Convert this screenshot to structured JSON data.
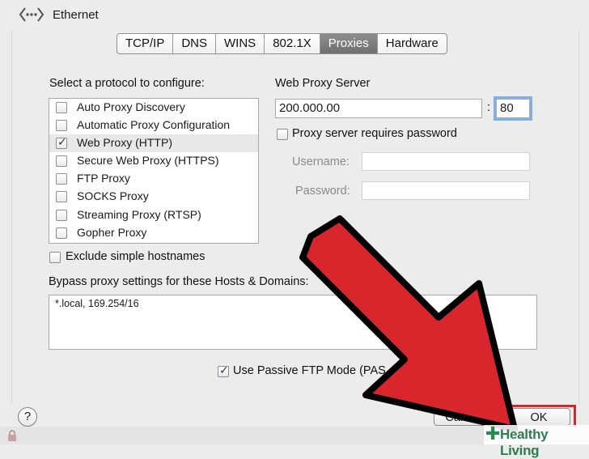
{
  "window": {
    "title": "Ethernet"
  },
  "tabs": [
    {
      "label": "TCP/IP",
      "active": false
    },
    {
      "label": "DNS",
      "active": false
    },
    {
      "label": "WINS",
      "active": false
    },
    {
      "label": "802.1X",
      "active": false
    },
    {
      "label": "Proxies",
      "active": true
    },
    {
      "label": "Hardware",
      "active": false
    }
  ],
  "protocols": {
    "heading": "Select a protocol to configure:",
    "items": [
      {
        "label": "Auto Proxy Discovery",
        "checked": false,
        "selected": false
      },
      {
        "label": "Automatic Proxy Configuration",
        "checked": false,
        "selected": false
      },
      {
        "label": "Web Proxy (HTTP)",
        "checked": true,
        "selected": true
      },
      {
        "label": "Secure Web Proxy (HTTPS)",
        "checked": false,
        "selected": false
      },
      {
        "label": "FTP Proxy",
        "checked": false,
        "selected": false
      },
      {
        "label": "SOCKS Proxy",
        "checked": false,
        "selected": false
      },
      {
        "label": "Streaming Proxy (RTSP)",
        "checked": false,
        "selected": false
      },
      {
        "label": "Gopher Proxy",
        "checked": false,
        "selected": false
      }
    ]
  },
  "server": {
    "heading": "Web Proxy Server",
    "address": "200.000.00",
    "separator": ":",
    "port": "80",
    "requires_password_label": "Proxy server requires password",
    "requires_password_checked": false,
    "username_label": "Username:",
    "username_value": "",
    "password_label": "Password:",
    "password_value": ""
  },
  "exclude": {
    "label": "Exclude simple hostnames",
    "checked": false
  },
  "bypass": {
    "label": "Bypass proxy settings for these Hosts & Domains:",
    "value": "*.local, 169.254/16"
  },
  "passive_ftp": {
    "label": "Use Passive FTP Mode (PAS",
    "checked": true
  },
  "footer": {
    "help_label": "?",
    "cancel_label": "Cancel",
    "ok_label": "OK"
  },
  "watermark": {
    "text": "Healthy Living"
  },
  "icons": {
    "back": "network-arrows-icon",
    "lock": "lock-icon",
    "check": "checkmark-icon",
    "plus": "plus-icon"
  },
  "colors": {
    "arrow_fill": "#d9262c",
    "arrow_outline": "#000000",
    "ok_highlight": "#d9262c",
    "tab_active": "#7a7a7a",
    "focus_ring": "#7fb0e6",
    "watermark": "#2e7d4e"
  }
}
